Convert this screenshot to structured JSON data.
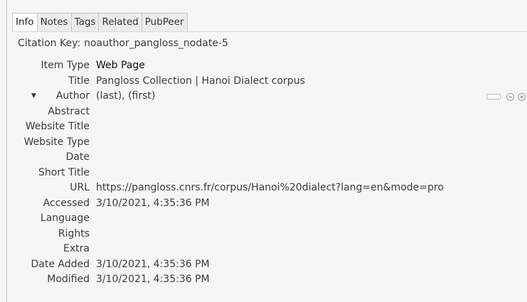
{
  "tabs": [
    {
      "label": "Info",
      "active": true
    },
    {
      "label": "Notes",
      "active": false
    },
    {
      "label": "Tags",
      "active": false
    },
    {
      "label": "Related",
      "active": false
    },
    {
      "label": "PubPeer",
      "active": false
    }
  ],
  "citation": {
    "label": "Citation Key:",
    "value": "noauthor_pangloss_nodate-5"
  },
  "fields": {
    "item_type": {
      "label": "Item Type",
      "value": "Web Page"
    },
    "title": {
      "label": "Title",
      "value": "Pangloss Collection | Hanoi Dialect corpus"
    },
    "author": {
      "label": "Author",
      "value": "(last), (first)",
      "twisty": "▼"
    },
    "abstract": {
      "label": "Abstract",
      "value": ""
    },
    "website_title": {
      "label": "Website Title",
      "value": ""
    },
    "website_type": {
      "label": "Website Type",
      "value": ""
    },
    "date": {
      "label": "Date",
      "value": ""
    },
    "short_title": {
      "label": "Short Title",
      "value": ""
    },
    "url": {
      "label": "URL",
      "value": "https://pangloss.cnrs.fr/corpus/Hanoi%20dialect?lang=en&mode=pro"
    },
    "accessed": {
      "label": "Accessed",
      "value": "3/10/2021, 4:35:36 PM"
    },
    "language": {
      "label": "Language",
      "value": ""
    },
    "rights": {
      "label": "Rights",
      "value": ""
    },
    "extra": {
      "label": "Extra",
      "value": ""
    },
    "date_added": {
      "label": "Date Added",
      "value": "3/10/2021, 4:35:36 PM"
    },
    "modified": {
      "label": "Modified",
      "value": "3/10/2021, 4:35:36 PM"
    }
  },
  "icons": {
    "creator_type_switch": "switch-icon",
    "remove_creator": "minus-circle-icon",
    "add_creator": "plus-circle-icon"
  }
}
